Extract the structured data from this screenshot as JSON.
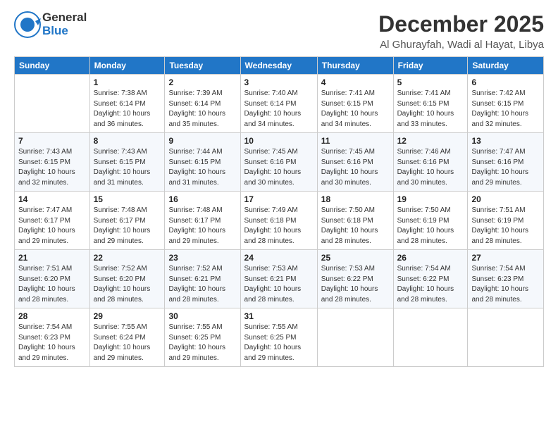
{
  "header": {
    "logo_general": "General",
    "logo_blue": "Blue",
    "month": "December 2025",
    "location": "Al Ghurayfah, Wadi al Hayat, Libya"
  },
  "days_of_week": [
    "Sunday",
    "Monday",
    "Tuesday",
    "Wednesday",
    "Thursday",
    "Friday",
    "Saturday"
  ],
  "weeks": [
    [
      {
        "day": "",
        "info": ""
      },
      {
        "day": "1",
        "info": "Sunrise: 7:38 AM\nSunset: 6:14 PM\nDaylight: 10 hours\nand 36 minutes."
      },
      {
        "day": "2",
        "info": "Sunrise: 7:39 AM\nSunset: 6:14 PM\nDaylight: 10 hours\nand 35 minutes."
      },
      {
        "day": "3",
        "info": "Sunrise: 7:40 AM\nSunset: 6:14 PM\nDaylight: 10 hours\nand 34 minutes."
      },
      {
        "day": "4",
        "info": "Sunrise: 7:41 AM\nSunset: 6:15 PM\nDaylight: 10 hours\nand 34 minutes."
      },
      {
        "day": "5",
        "info": "Sunrise: 7:41 AM\nSunset: 6:15 PM\nDaylight: 10 hours\nand 33 minutes."
      },
      {
        "day": "6",
        "info": "Sunrise: 7:42 AM\nSunset: 6:15 PM\nDaylight: 10 hours\nand 32 minutes."
      }
    ],
    [
      {
        "day": "7",
        "info": "Sunrise: 7:43 AM\nSunset: 6:15 PM\nDaylight: 10 hours\nand 32 minutes."
      },
      {
        "day": "8",
        "info": "Sunrise: 7:43 AM\nSunset: 6:15 PM\nDaylight: 10 hours\nand 31 minutes."
      },
      {
        "day": "9",
        "info": "Sunrise: 7:44 AM\nSunset: 6:15 PM\nDaylight: 10 hours\nand 31 minutes."
      },
      {
        "day": "10",
        "info": "Sunrise: 7:45 AM\nSunset: 6:16 PM\nDaylight: 10 hours\nand 30 minutes."
      },
      {
        "day": "11",
        "info": "Sunrise: 7:45 AM\nSunset: 6:16 PM\nDaylight: 10 hours\nand 30 minutes."
      },
      {
        "day": "12",
        "info": "Sunrise: 7:46 AM\nSunset: 6:16 PM\nDaylight: 10 hours\nand 30 minutes."
      },
      {
        "day": "13",
        "info": "Sunrise: 7:47 AM\nSunset: 6:16 PM\nDaylight: 10 hours\nand 29 minutes."
      }
    ],
    [
      {
        "day": "14",
        "info": "Sunrise: 7:47 AM\nSunset: 6:17 PM\nDaylight: 10 hours\nand 29 minutes."
      },
      {
        "day": "15",
        "info": "Sunrise: 7:48 AM\nSunset: 6:17 PM\nDaylight: 10 hours\nand 29 minutes."
      },
      {
        "day": "16",
        "info": "Sunrise: 7:48 AM\nSunset: 6:17 PM\nDaylight: 10 hours\nand 29 minutes."
      },
      {
        "day": "17",
        "info": "Sunrise: 7:49 AM\nSunset: 6:18 PM\nDaylight: 10 hours\nand 28 minutes."
      },
      {
        "day": "18",
        "info": "Sunrise: 7:50 AM\nSunset: 6:18 PM\nDaylight: 10 hours\nand 28 minutes."
      },
      {
        "day": "19",
        "info": "Sunrise: 7:50 AM\nSunset: 6:19 PM\nDaylight: 10 hours\nand 28 minutes."
      },
      {
        "day": "20",
        "info": "Sunrise: 7:51 AM\nSunset: 6:19 PM\nDaylight: 10 hours\nand 28 minutes."
      }
    ],
    [
      {
        "day": "21",
        "info": "Sunrise: 7:51 AM\nSunset: 6:20 PM\nDaylight: 10 hours\nand 28 minutes."
      },
      {
        "day": "22",
        "info": "Sunrise: 7:52 AM\nSunset: 6:20 PM\nDaylight: 10 hours\nand 28 minutes."
      },
      {
        "day": "23",
        "info": "Sunrise: 7:52 AM\nSunset: 6:21 PM\nDaylight: 10 hours\nand 28 minutes."
      },
      {
        "day": "24",
        "info": "Sunrise: 7:53 AM\nSunset: 6:21 PM\nDaylight: 10 hours\nand 28 minutes."
      },
      {
        "day": "25",
        "info": "Sunrise: 7:53 AM\nSunset: 6:22 PM\nDaylight: 10 hours\nand 28 minutes."
      },
      {
        "day": "26",
        "info": "Sunrise: 7:54 AM\nSunset: 6:22 PM\nDaylight: 10 hours\nand 28 minutes."
      },
      {
        "day": "27",
        "info": "Sunrise: 7:54 AM\nSunset: 6:23 PM\nDaylight: 10 hours\nand 28 minutes."
      }
    ],
    [
      {
        "day": "28",
        "info": "Sunrise: 7:54 AM\nSunset: 6:23 PM\nDaylight: 10 hours\nand 29 minutes."
      },
      {
        "day": "29",
        "info": "Sunrise: 7:55 AM\nSunset: 6:24 PM\nDaylight: 10 hours\nand 29 minutes."
      },
      {
        "day": "30",
        "info": "Sunrise: 7:55 AM\nSunset: 6:25 PM\nDaylight: 10 hours\nand 29 minutes."
      },
      {
        "day": "31",
        "info": "Sunrise: 7:55 AM\nSunset: 6:25 PM\nDaylight: 10 hours\nand 29 minutes."
      },
      {
        "day": "",
        "info": ""
      },
      {
        "day": "",
        "info": ""
      },
      {
        "day": "",
        "info": ""
      }
    ]
  ]
}
